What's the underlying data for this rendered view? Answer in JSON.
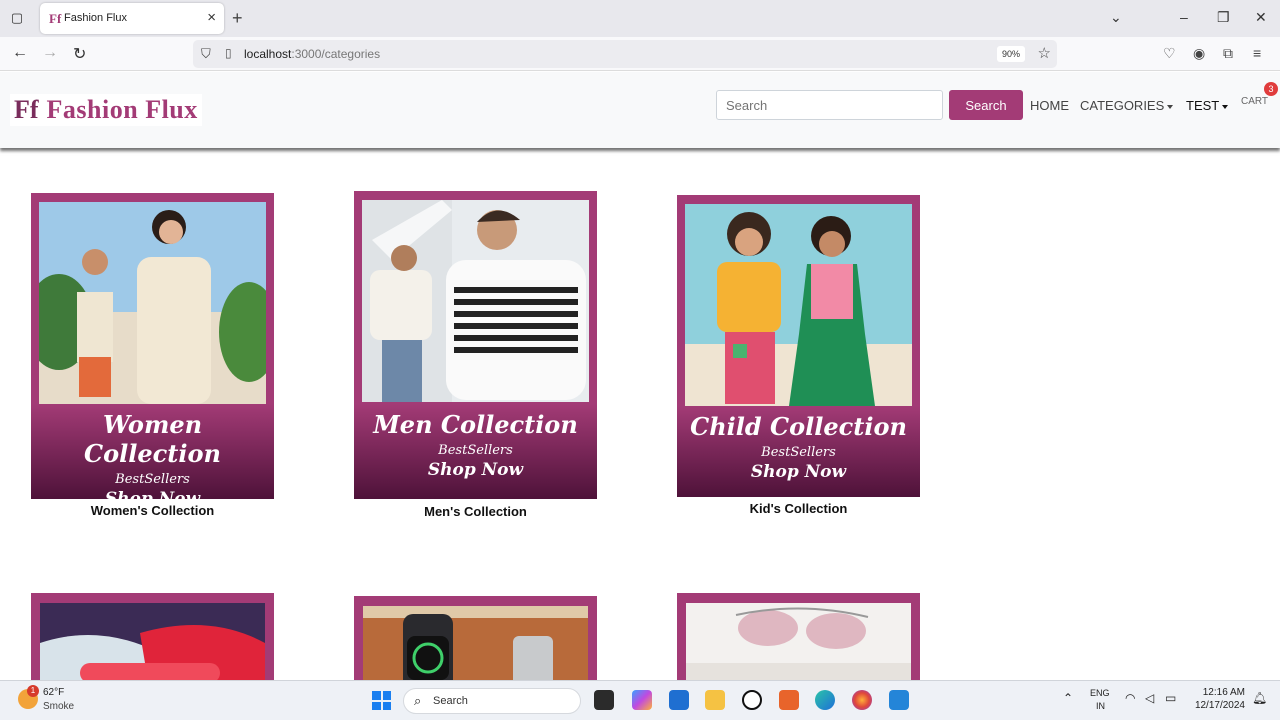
{
  "browser": {
    "tab_title": "Fashion Flux",
    "tab_favicon": "Ff",
    "url_host": "localhost",
    "url_path": ":3000/categories",
    "zoom": "90%"
  },
  "site": {
    "logo_mark": "Ff",
    "logo_text": "Fashion Flux",
    "search_placeholder": "Search",
    "search_button": "Search",
    "nav": {
      "home": "HOME",
      "categories": "CATEGORIES",
      "user": "TEST",
      "cart": "CART",
      "cart_count": "3"
    }
  },
  "categories": [
    {
      "banner_title": "Women Collection",
      "banner_sub": "BestSellers",
      "banner_cta": "Shop Now",
      "caption": "Women's Collection"
    },
    {
      "banner_title": "Men Collection",
      "banner_sub": "BestSellers",
      "banner_cta": "Shop Now",
      "caption": "Men's Collection"
    },
    {
      "banner_title": "Child Collection",
      "banner_sub": "BestSellers",
      "banner_cta": "Shop Now",
      "caption": "Kid's Collection"
    }
  ],
  "taskbar": {
    "weather_temp": "62°F",
    "weather_desc": "Smoke",
    "weather_badge": "1",
    "search_label": "Search",
    "lang_top": "ENG",
    "lang_bottom": "IN",
    "time": "12:16 AM",
    "date": "12/17/2024"
  },
  "colors": {
    "accent": "#a33b76"
  }
}
